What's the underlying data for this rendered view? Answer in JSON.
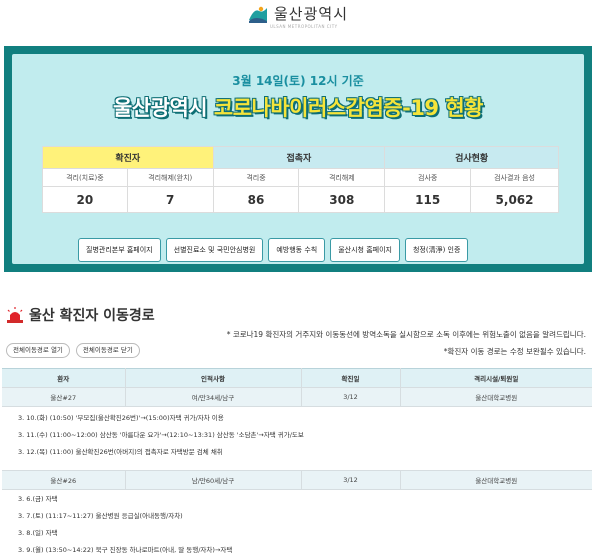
{
  "header": {
    "city_name": "울산광역시",
    "city_sub": "ULSAN METROPOLITAN CITY"
  },
  "status": {
    "date_line": "3월  14일(토) 12시 기준",
    "title_part1": "울산광역시 ",
    "title_part2": "코로나바이러스감염증-19 현황",
    "groups": {
      "confirmed": "확진자",
      "contacts": "접촉자",
      "tests": "검사현황"
    },
    "columns": [
      "격리(치료)중",
      "격리해제(완치)",
      "격리중",
      "격리해제",
      "검사중",
      "검사결과 음성"
    ],
    "values": [
      "20",
      "7",
      "86",
      "308",
      "115",
      "5,062"
    ],
    "buttons": [
      "질병관리본부 홈페이지",
      "선별진료소 및 국민안심병원",
      "예방행동 수칙",
      "울산시청 홈페이지",
      "청정(淸淨) 인증"
    ]
  },
  "route": {
    "title": "울산 확진자 이동경로",
    "notice1": "* 코로나19 확진자의 거주지와 이동동선에 방역소독을 실시함으로 소독 이후에는 위험노출이 없음을 알려드립니다.",
    "notice2": "*확진자 이동 경로는 수정 보완될수 있습니다.",
    "open_all": "전체이동경로 열기",
    "close_all": "전체이동경로 닫기",
    "columns": [
      "환자",
      "인적사항",
      "확진일",
      "격리시설/퇴원일"
    ],
    "patients": [
      {
        "id": "울산#27",
        "info": "여/만34세/남구",
        "date": "3/12",
        "facility": "울산대학교병원",
        "steps": [
          "3. 10.(화) (10:50) '부모집(울산확진26번)'→(15:00)자택 귀가/자차 이용",
          "3. 11.(수) (11:00~12:00) 삼산동 '아름다운 요가'→(12:10~13:31) 삼산동 '소담촌'→자택 귀가/도보",
          "3. 12.(목) (11:00) 울산확진26번(아버지)의 접촉자로 자택방문 검체 채취"
        ]
      },
      {
        "id": "울산#26",
        "info": "남/만60세/남구",
        "date": "3/12",
        "facility": "울산대학교병원",
        "steps": [
          "3. 6.(금) 자택",
          "3. 7.(토) (11:17~11:27) 울산병원 응급실(아내동행/자차)",
          "3. 8.(일) 자택",
          "3. 9.(월) (13:50~14:22) 북구 진장동 하나로마트(아내, 딸 동행/자차)→자택"
        ]
      }
    ]
  },
  "colors": {
    "teal_frame": "#117f7f",
    "panel_bg": "#c1ecee",
    "title_yellow": "#f5e43a",
    "confirmed_header": "#fff27a",
    "contacts_header": "#c7eaf0",
    "alert_red": "#e0242b"
  }
}
